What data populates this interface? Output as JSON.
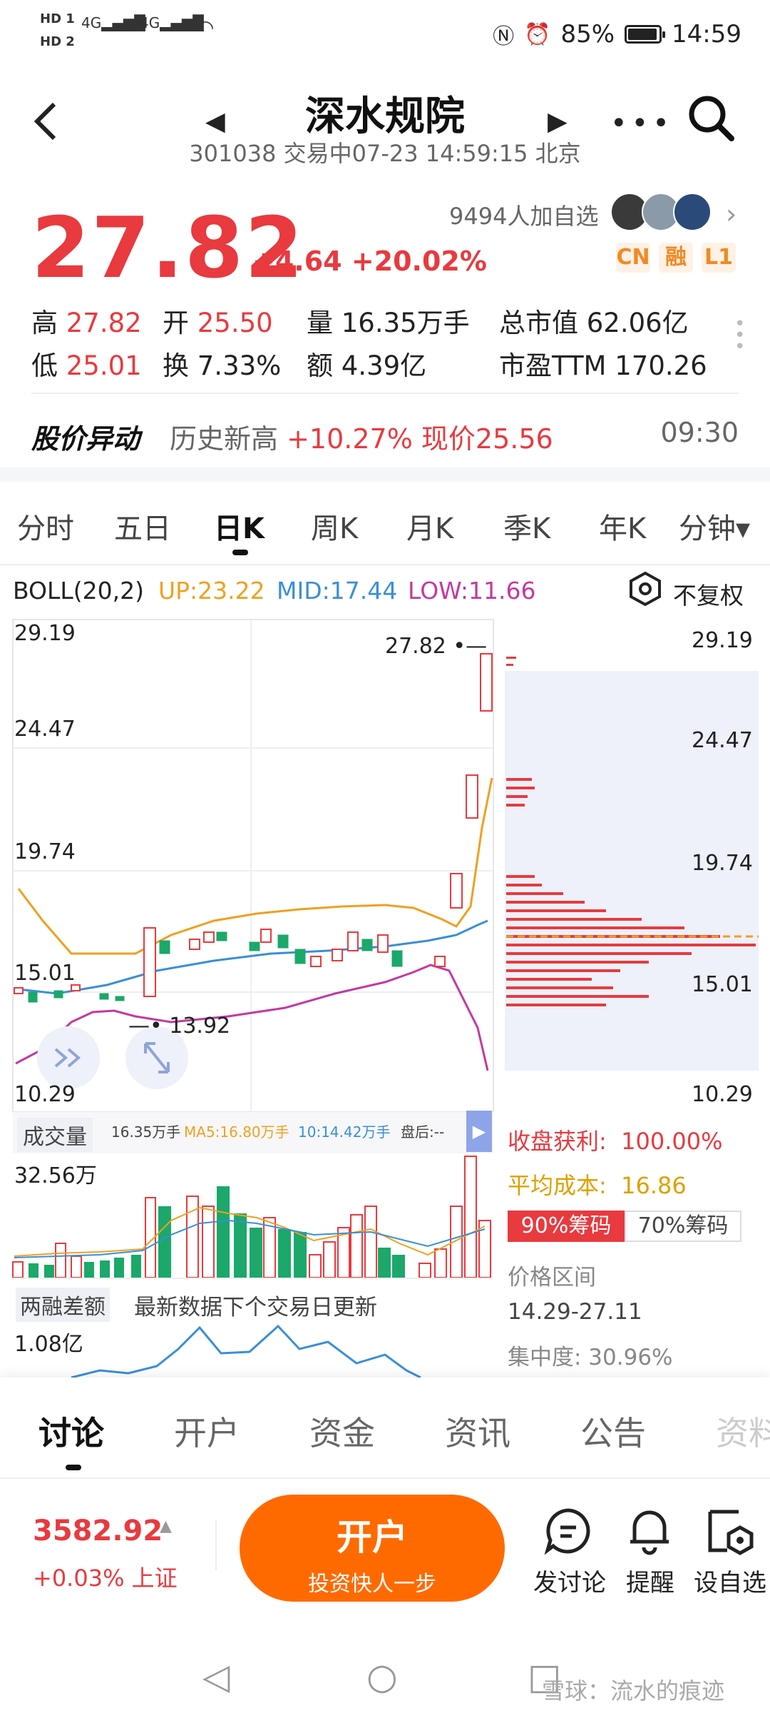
{
  "status_bar": {
    "hd1": "HD 1",
    "hd2": "HD 2",
    "net1": "4G",
    "net2": "4G",
    "battery": "85%",
    "time": "14:59"
  },
  "header": {
    "title": "深水规院",
    "subtitle": "301038 交易中07-23 14:59:15 北京"
  },
  "quote": {
    "price": "27.82",
    "change": "+4.64 +20.02%",
    "watchers": "9494人加自选",
    "badges": [
      "CN",
      "融",
      "L1"
    ],
    "stats": {
      "high_label": "高",
      "high": "27.82",
      "open_label": "开",
      "open": "25.50",
      "volume": "量 16.35万手",
      "market_cap": "总市值 62.06亿",
      "low_label": "低",
      "low": "25.01",
      "turnover": "换 7.33%",
      "amount": "额 4.39亿",
      "pe": "市盈TTM 170.26"
    }
  },
  "alert": {
    "title": "股价异动",
    "prefix": "历史新高 ",
    "value": "+10.27% 现价25.56",
    "time": "09:30"
  },
  "period_tabs": [
    "分时",
    "五日",
    "日K",
    "周K",
    "月K",
    "季K",
    "年K",
    "分钟▾"
  ],
  "boll": {
    "label": "BOLL(20,2)",
    "up": "UP:23.22",
    "mid": "MID:17.44",
    "low": "LOW:11.66",
    "adjust": "不复权",
    "colors": {
      "up": "#f0a020",
      "mid": "#3a8fd8",
      "low": "#c23aa0"
    }
  },
  "kline": {
    "y_ticks": [
      "29.19",
      "24.47",
      "19.74",
      "15.01",
      "10.29"
    ],
    "max_label": "27.82",
    "min_label": "13.92"
  },
  "chips": {
    "profit_label": "收盘获利:",
    "profit_value": "100.00%",
    "avg_label": "平均成本:",
    "avg_value": "16.86",
    "tab_90": "90%筹码",
    "tab_70": "70%筹码",
    "range_label": "价格区间",
    "range_value": "14.29-27.11",
    "concentration": "集中度: 30.96%"
  },
  "volume": {
    "label": "成交量",
    "vol": "16.35万手",
    "ma5": "MA5:16.80万手",
    "ma10": "10:14.42万手",
    "pan": "盘后:--",
    "max": "32.56万"
  },
  "margin": {
    "label": "两融差额",
    "note": "最新数据下个交易日更新",
    "max": "1.08亿"
  },
  "bottom_tabs": [
    "讨论",
    "开户",
    "资金",
    "资讯",
    "公告",
    "资料"
  ],
  "footer": {
    "index_value": "3582.92",
    "index_change": "+0.03% 上证",
    "open_main": "开户",
    "open_sub": "投资快人一步",
    "actions": [
      "发讨论",
      "提醒",
      "设自选"
    ]
  },
  "watermark": "雪球：流水的痕迹"
}
